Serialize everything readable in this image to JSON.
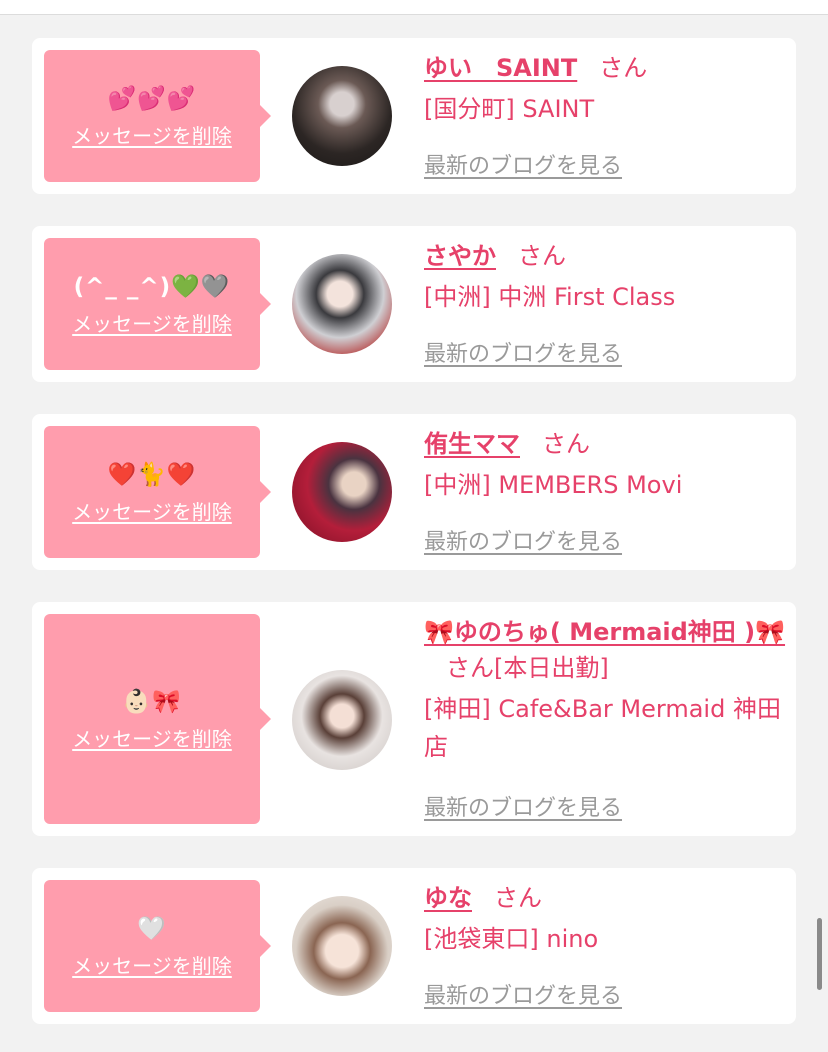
{
  "delete_label": "メッセージを削除",
  "blog_label": "最新のブログを見る",
  "san": "さん",
  "colors": {
    "bubble": "#ff9dad",
    "accent": "#e6416a",
    "muted": "#9a9a9a"
  },
  "messages": [
    {
      "bubble_text": "💕💕💕",
      "name": "ゆい　SAINT",
      "tag": "",
      "shop": "[国分町] SAINT"
    },
    {
      "bubble_text": "(^_ _^)💚🩶",
      "name": "さやか",
      "tag": "",
      "shop": "[中洲] 中洲 First Class"
    },
    {
      "bubble_text": "❤️🐈❤️",
      "name": "侑生ママ",
      "tag": "",
      "shop": "[中洲] MEMBERS Movi"
    },
    {
      "bubble_text": "👶🏻🎀",
      "name": "🎀ゆのちゅ( Mermaid神田 )🎀",
      "tag": "[本日出勤]",
      "shop": "[神田] Cafe&Bar Mermaid 神田店"
    },
    {
      "bubble_text": "🤍",
      "name": "ゆな",
      "tag": "",
      "shop": "[池袋東口] nino"
    }
  ]
}
